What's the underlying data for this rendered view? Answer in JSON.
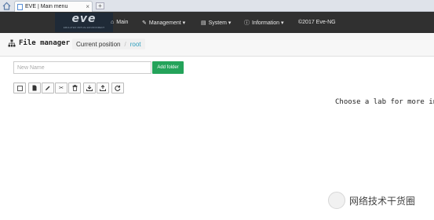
{
  "browser": {
    "tab_title": "EVE | Main menu",
    "close_glyph": "×",
    "new_tab_glyph": "+"
  },
  "navbar": {
    "logo_text": "eve",
    "logo_sub": "EMULATED VIRTUAL ENVIRONMENT",
    "items": [
      {
        "label": "Main",
        "icon": "home-icon"
      },
      {
        "label": "Management ▾",
        "icon": "wrench-icon"
      },
      {
        "label": "System ▾",
        "icon": "hdd-icon"
      },
      {
        "label": "Information ▾",
        "icon": "info-circle-icon"
      },
      {
        "label": "©2017 Eve-NG",
        "icon": ""
      }
    ]
  },
  "header": {
    "title": "File manager",
    "breadcrumb_label": "Current position",
    "breadcrumb_sep": "/",
    "breadcrumb_current": "root"
  },
  "form": {
    "name_placeholder": "New Name",
    "add_folder_label": "Add folder"
  },
  "toolbar": {
    "buttons": [
      "select-all-icon",
      "file-icon",
      "pencil-icon",
      "scissors-icon",
      "trash-icon",
      "download-icon",
      "upload-icon",
      "refresh-icon"
    ]
  },
  "content": {
    "message": "Choose a lab for more info"
  },
  "watermark": {
    "text": "网络技术干货圈"
  },
  "colors": {
    "navbar_bg": "#303030",
    "add_button": "#24a35a",
    "breadcrumb_current": "#2a9dbd"
  }
}
